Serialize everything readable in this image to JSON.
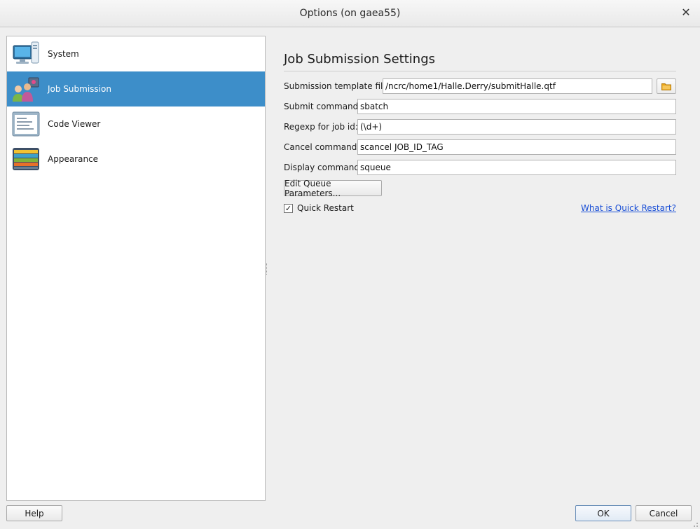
{
  "window": {
    "title": "Options (on gaea55)",
    "close_glyph": "✕"
  },
  "sidebar": {
    "items": [
      {
        "label": "System",
        "icon": "computer-icon",
        "selected": false
      },
      {
        "label": "Job Submission",
        "icon": "users-icon",
        "selected": true
      },
      {
        "label": "Code Viewer",
        "icon": "document-icon",
        "selected": false
      },
      {
        "label": "Appearance",
        "icon": "palette-icon",
        "selected": false
      }
    ],
    "selected_color": "#3d8ec9"
  },
  "panel": {
    "title": "Job Submission Settings",
    "fields": [
      {
        "label": "Submission template file:",
        "value": "/ncrc/home1/Halle.Derry/submitHalle.qtf"
      },
      {
        "label": "Submit command:",
        "value": "sbatch"
      },
      {
        "label": "Regexp for job id:",
        "value": "(\\d+)"
      },
      {
        "label": "Cancel command:",
        "value": "scancel JOB_ID_TAG"
      },
      {
        "label": "Display command:",
        "value": "squeue"
      }
    ],
    "edit_queue_label": "Edit Queue Parameters...",
    "quick_restart": {
      "label": "Quick Restart",
      "checked": true,
      "check_glyph": "✓"
    },
    "quick_restart_link": "What is Quick Restart?"
  },
  "footer": {
    "help_label": "Help",
    "ok_label": "OK",
    "cancel_label": "Cancel"
  },
  "colors": {
    "link": "#1a4fd6",
    "folder_icon": "#e8a317"
  }
}
